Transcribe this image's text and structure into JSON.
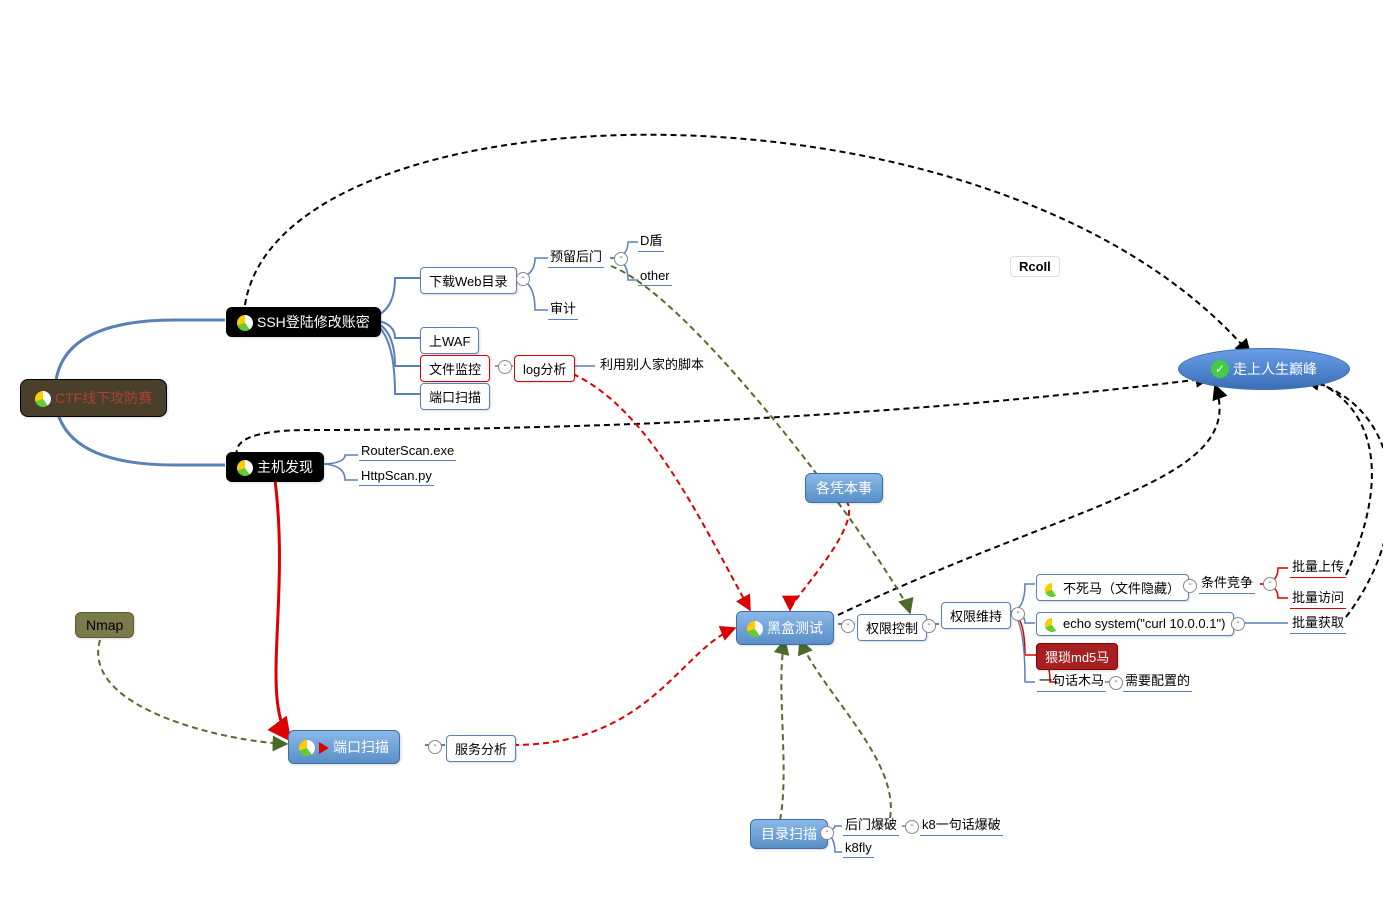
{
  "label": "RcoIl",
  "root": "CTF线下攻防赛",
  "ssh": "SSH登陆修改账密",
  "host_discovery": "主机发现",
  "nmap": "Nmap",
  "port_scan": "端口扫描",
  "download_web": "下载Web目录",
  "upload_waf": "上WAF",
  "file_monitor": "文件监控",
  "port_scan_sub": "端口扫描",
  "backdoor_reserved": "预留后门",
  "d_shield": "D盾",
  "other": "other",
  "audit": "审计",
  "log_analysis": "log分析",
  "use_others_script": "利用别人家的脚本",
  "router_scan": "RouterScan.exe",
  "http_scan": "HttpScan.py",
  "skill": "各凭本事",
  "blackbox": "黑盒测试",
  "priv_control": "权限控制",
  "priv_maintain": "权限维持",
  "webshell": "一句话木马",
  "immortal": "不死马（文件隐藏）",
  "echo_system": "echo system(\"curl 10.0.0.1\")",
  "md5_horse": "猥琐md5马",
  "race_condition": "条件竞争",
  "batch_upload": "批量上传",
  "batch_visit": "批量访问",
  "batch_get": "批量获取",
  "need_config": "需要配置的",
  "dir_scan": "目录扫描",
  "backdoor_brute": "后门爆破",
  "k8_brute": "k8一句话爆破",
  "k8fly": "k8fly",
  "service_analysis": "服务分析",
  "climb": "走上人生巅峰"
}
